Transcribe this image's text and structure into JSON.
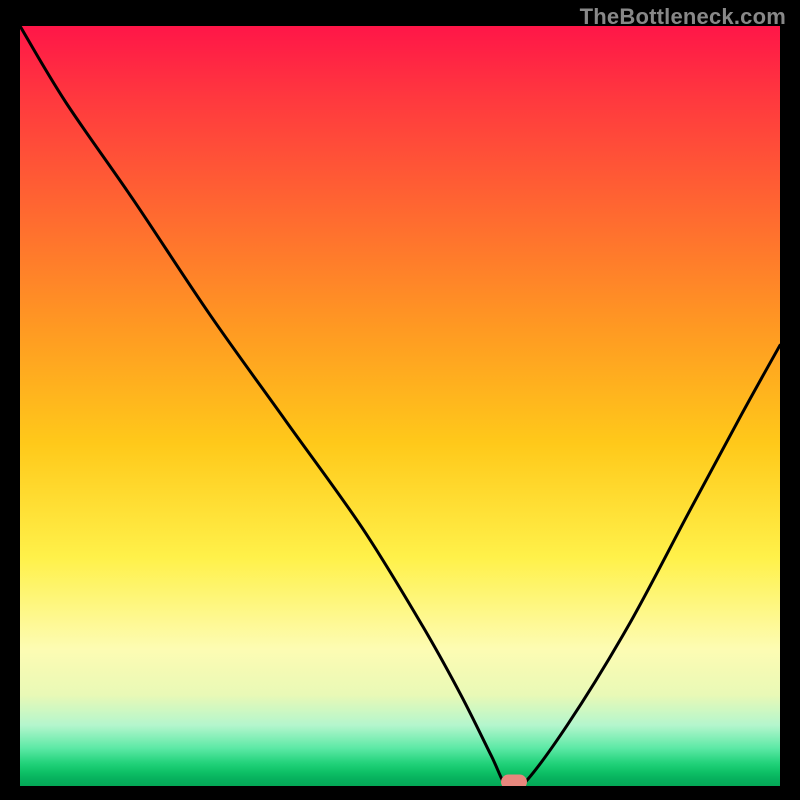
{
  "watermark": "TheBottleneck.com",
  "chart_data": {
    "type": "line",
    "title": "",
    "xlabel": "",
    "ylabel": "",
    "xlim": [
      0,
      100
    ],
    "ylim": [
      0,
      100
    ],
    "grid": false,
    "legend": false,
    "series": [
      {
        "name": "bottleneck-curve",
        "x": [
          0,
          6,
          15,
          25,
          35,
          45,
          53,
          58,
          62,
          64,
          66,
          72,
          80,
          88,
          95,
          100
        ],
        "values": [
          0,
          10,
          23,
          38,
          52,
          66,
          79,
          88,
          96,
          100,
          100,
          92,
          79,
          64,
          51,
          42
        ]
      }
    ],
    "annotations": [
      {
        "name": "optimal-marker",
        "x": 65,
        "y": 100
      }
    ],
    "gradient_stops": [
      {
        "pos": 0,
        "color": "#ff1648"
      },
      {
        "pos": 100,
        "color": "#04a856"
      }
    ]
  }
}
